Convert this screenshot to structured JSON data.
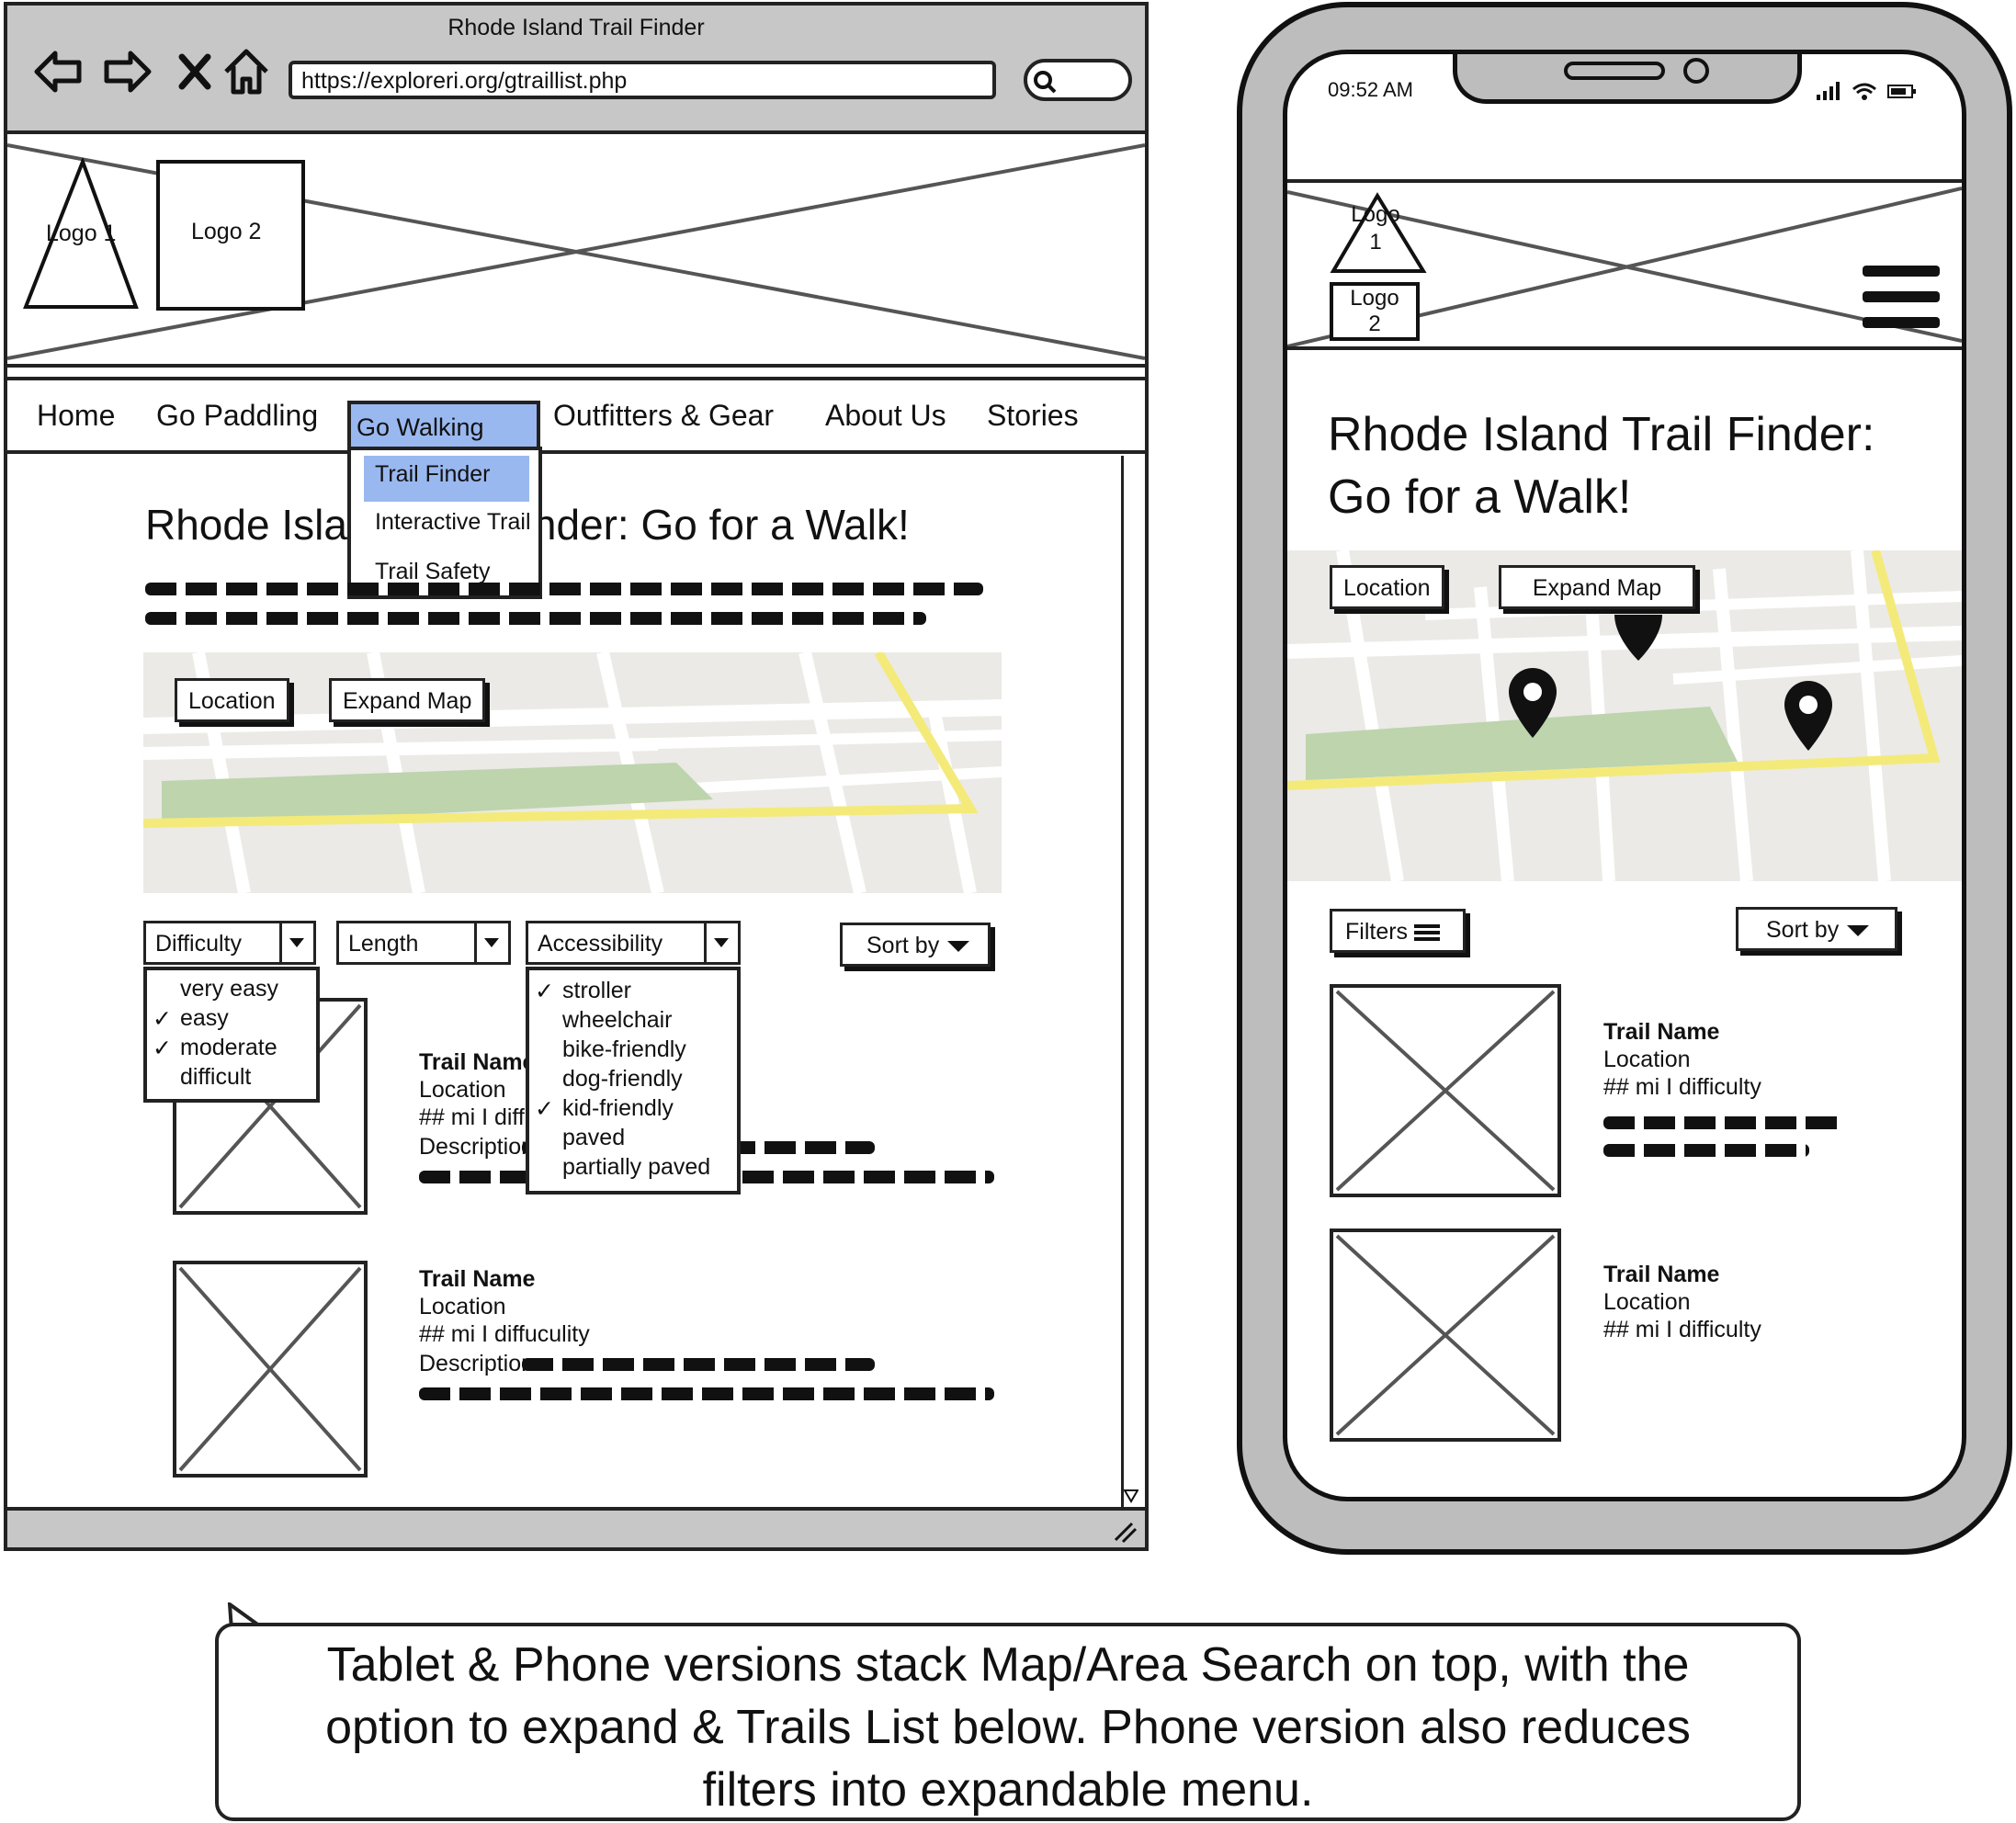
{
  "browser": {
    "title": "Rhode Island Trail Finder",
    "url": "https://exploreri.org/gtraillist.php"
  },
  "logos": {
    "logo1": "Logo 1",
    "logo2": "Logo 2"
  },
  "phone_logos": {
    "logo1_a": "Logo",
    "logo1_b": "1",
    "logo2_a": "Logo",
    "logo2_b": "2"
  },
  "nav": {
    "items": [
      "Home",
      "Go Paddling",
      "Go Walking",
      "Outfitters & Gear",
      "About Us",
      "Stories"
    ],
    "dropdown": [
      "Trail Finder",
      "Interactive Trail Map",
      "Trail Safety"
    ]
  },
  "page": {
    "title": "Rhode Island Trail Finder: Go for a Walk!",
    "location_button": "Location",
    "expand_map_button": "Expand Map",
    "sort_label": "Sort by",
    "filters_label": "Filters"
  },
  "filters": {
    "difficulty": {
      "label": "Difficulty",
      "options": [
        {
          "label": "very easy",
          "checked": false
        },
        {
          "label": "easy",
          "checked": true
        },
        {
          "label": "moderate",
          "checked": true
        },
        {
          "label": "difficult",
          "checked": false
        }
      ]
    },
    "length": {
      "label": "Length"
    },
    "accessibility": {
      "label": "Accessibility",
      "options": [
        {
          "label": "stroller",
          "checked": true
        },
        {
          "label": "wheelchair",
          "checked": false
        },
        {
          "label": "bike-friendly",
          "checked": false
        },
        {
          "label": "dog-friendly",
          "checked": false
        },
        {
          "label": "kid-friendly",
          "checked": true
        },
        {
          "label": "paved",
          "checked": false
        },
        {
          "label": "partially paved",
          "checked": false
        }
      ]
    }
  },
  "desktop_trails": [
    {
      "name": "Trail Name",
      "location": "Location",
      "stats": "## mi I difficulty",
      "description": "Description:"
    },
    {
      "name": "Trail Name",
      "location": "Location",
      "stats": "## mi I diffuculity",
      "description": "Description:"
    }
  ],
  "phone": {
    "time": "09:52 AM",
    "title_line1": "Rhode Island Trail Finder:",
    "title_line2": "Go for a Walk!",
    "trails": [
      {
        "name": "Trail Name",
        "location": "Location",
        "stats": "## mi I difficulty"
      },
      {
        "name": "Trail Name",
        "location": "Location",
        "stats": "## mi I difficulty"
      }
    ]
  },
  "caption": {
    "line1": "Tablet & Phone versions stack Map/Area Search on top, with the",
    "line2": "option to expand & Trails List below. Phone version also reduces",
    "line3": "filters into expandable menu."
  },
  "colors": {
    "chrome": "#c7c7c7",
    "nav_highlight": "#9ab8f0",
    "map_bg": "#ebeae6",
    "map_park": "#bdd4ad",
    "map_route": "#f4ea7a"
  }
}
